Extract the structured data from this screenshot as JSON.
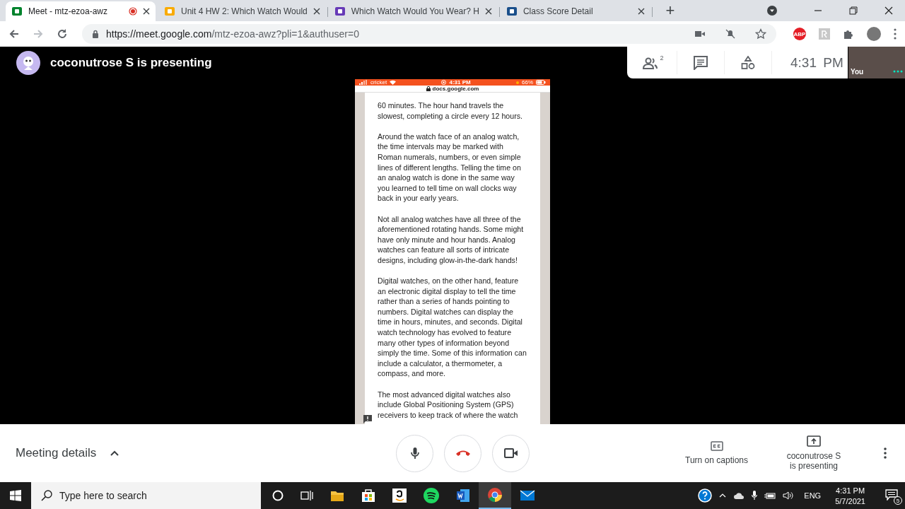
{
  "browser": {
    "tabs": [
      {
        "kind": "meet",
        "title": "Meet - mtz-ezoa-awz",
        "selected": true,
        "recording": true
      },
      {
        "kind": "classroom",
        "title": "Unit 4 HW 2: Which Watch Would",
        "selected": false,
        "recording": false
      },
      {
        "kind": "forms",
        "title": "Which Watch Would You Wear? H",
        "selected": false,
        "recording": false
      },
      {
        "kind": "score",
        "title": "Class Score Detail",
        "selected": false,
        "recording": false
      }
    ],
    "new_tab": "+",
    "url": {
      "host": "https://meet.google.com",
      "path": "/mtz-ezoa-awz?pli=1&authuser=0"
    },
    "adblock_badge": "ABP"
  },
  "meeting": {
    "presenter_banner": "coconutrose S is presenting",
    "participant_count": "2",
    "clock": "4:31 PM",
    "self_view_label": "You"
  },
  "shared_phone": {
    "carrier": "cricket",
    "time": "4:31 PM",
    "battery": "66%",
    "url": "docs.google.com",
    "paragraphs": [
      "60 minutes. The hour hand travels the slowest, completing a circle every 12 hours.",
      "Around the watch face of an analog watch, the time intervals may be marked with Roman numerals, numbers, or even simple lines of different lengths. Telling the time on an analog watch is done in the same way you learned to tell time on wall clocks way back in your early years.",
      "Not all analog watches have all three of the aforementioned rotating hands. Some might have only minute and hour hands. Analog watches can feature all sorts of intricate designs, including glow-in-the-dark hands!",
      "Digital watches, on the other hand, feature an electronic digital display to tell the time rather than a series of hands pointing to numbers. Digital watches can display the time in hours, minutes, and seconds. Digital watch technology has evolved to feature many other types of information beyond simply the time. Some of this information can include a calculator, a thermometer, a compass, and more.",
      "The most advanced digital watches also include Global Positioning System (GPS) receivers to keep track of where the watch"
    ]
  },
  "controls": {
    "meeting_details": "Meeting details",
    "captions": "Turn on captions",
    "presenting": "coconutrose S is presenting"
  },
  "taskbar": {
    "search_placeholder": "Type here to search",
    "language": "ENG",
    "time": "4:31 PM",
    "date": "5/7/2021",
    "notification_count": "5"
  }
}
